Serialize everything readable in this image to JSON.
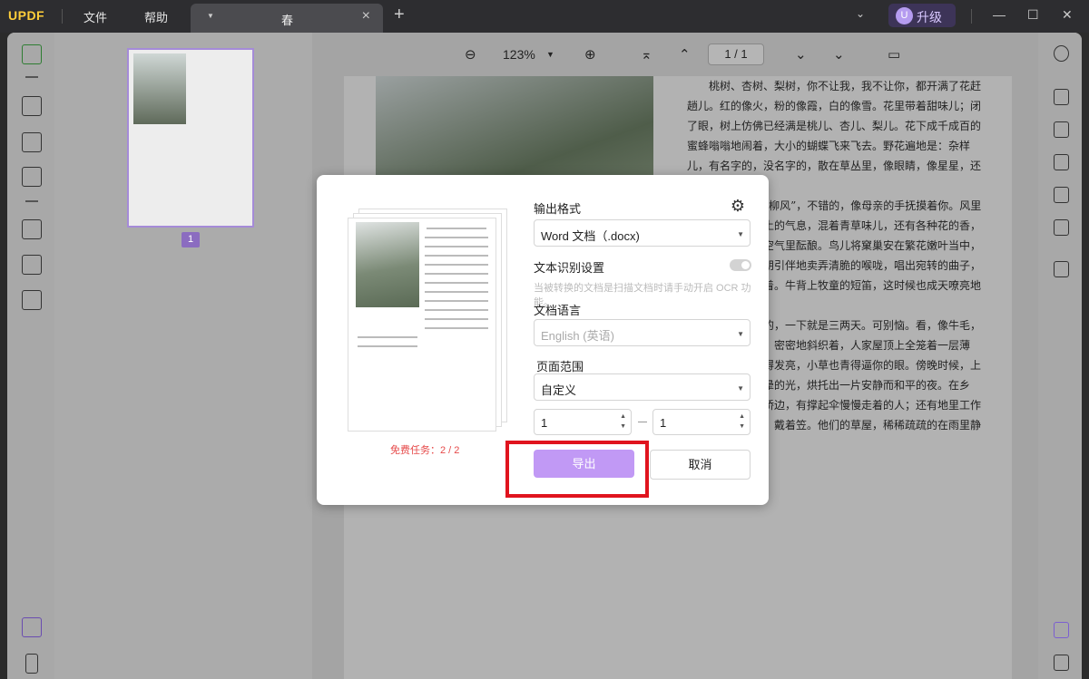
{
  "titlebar": {
    "logo": "UPDF",
    "menu": [
      "文件",
      "帮助"
    ],
    "tab_title": "春",
    "upgrade_label": "升级",
    "avatar_initial": "U"
  },
  "thumbnails": {
    "page_number": "1"
  },
  "viewer_toolbar": {
    "zoom": "123%",
    "page_indicator": "1 / 1"
  },
  "document": {
    "paragraphs": [
      "桃树、杏树、梨树，你不让我，我不让你，都开满了花赶趟儿。红的像火，粉的像霞，白的像雪。花里带着甜味儿；闭了眼，树上仿佛已经满是桃儿、杏儿、梨儿。花下成千成百的蜜蜂嗡嗡地闹着，大小的蝴蝶飞来飞去。野花遍地是：杂样儿，有名字的，没名字的，散在草丛里，像眼睛，像星星，还眨呀眨的。",
      "“吹面不寒杨柳风”，不错的，像母亲的手抚摸着你。风里带来些新翻的泥土的气息，混着青草味儿，还有各种花的香，都在微微润湿的空气里酝酿。鸟儿将窠巢安在繁花嫩叶当中，高兴起来了，呼朋引伴地卖弄清脆的喉咙，唱出宛转的曲子，与轻风流水应和着。牛背上牧童的短笛，这时候也成天嘹亮地响。",
      "雨是最寻常的，一下就是三两天。可别恼。看，像牛毛，像花针，像细丝，密密地斜织着，人家屋顶上全笼着一层薄烟。树叶儿却绿得发亮，小草也青得逼你的眼。傍晚时候，上灯了，一点点黄晕的光，烘托出一片安静而和平的夜。在乡下，小路上，石桥边，有撑起伞慢慢走着的人；还有地里工作的农民，披着蓑，戴着笠。他们的草屋，稀稀疏疏的在雨里静默着。"
    ]
  },
  "dialog": {
    "free_tasks": "免费任务：2 / 2",
    "output_format_label": "输出格式",
    "output_format_value": "Word 文档（.docx)",
    "ocr_label": "文本识别设置",
    "ocr_hint": "当被转换的文档是扫描文档时请手动开启 OCR 功能。",
    "language_label": "文档语言",
    "language_value": "English (英语)",
    "page_range_label": "页面范围",
    "page_range_value": "自定义",
    "range_from": "1",
    "range_to": "1",
    "export_label": "导出",
    "cancel_label": "取消",
    "accent_color": "#c199f5",
    "highlight_color": "#e0141e"
  }
}
